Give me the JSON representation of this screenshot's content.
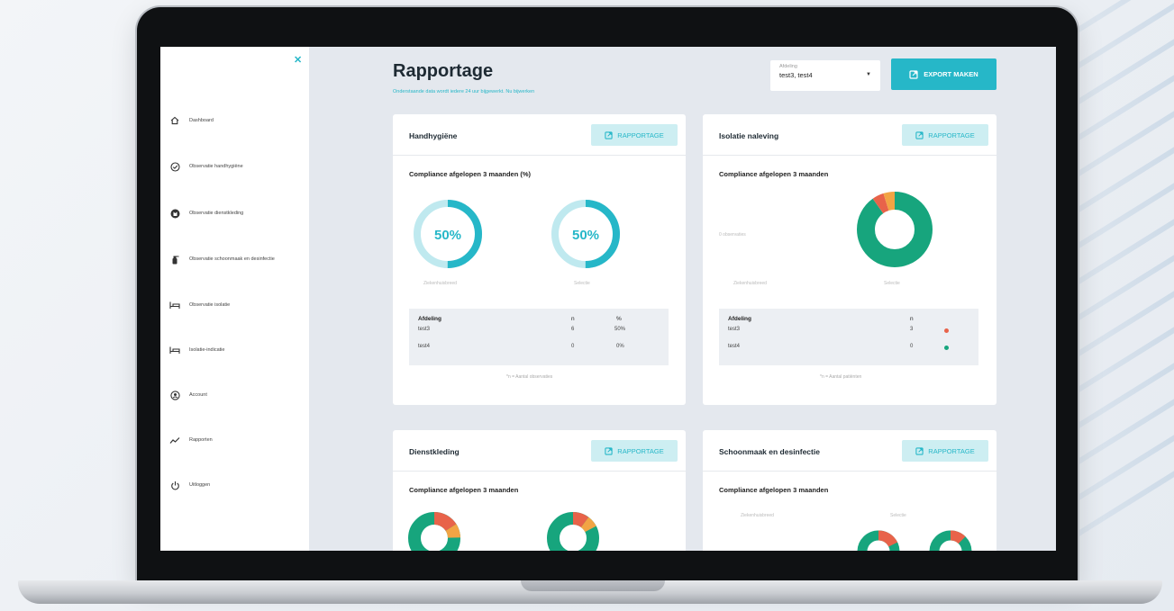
{
  "sidebar": {
    "close_icon": "close-icon",
    "items": [
      {
        "label": "Dashboard",
        "icon": "home-icon"
      },
      {
        "label": "Observatie handhygiëne",
        "icon": "check-circle-icon"
      },
      {
        "label": "Observatie dienstkleding",
        "icon": "uniform-icon"
      },
      {
        "label": "Observatie schoonmaak en desinfectie",
        "icon": "spray-bottle-icon"
      },
      {
        "label": "Observatie isolatie",
        "icon": "bed-icon"
      },
      {
        "label": "Isolatie-indicatie",
        "icon": "bed-icon"
      },
      {
        "label": "Account",
        "icon": "user-circle-icon"
      },
      {
        "label": "Rapporten",
        "icon": "trend-line-icon"
      },
      {
        "label": "Uitloggen",
        "icon": "power-icon"
      }
    ]
  },
  "header": {
    "title": "Rapportage",
    "subtitle": "Onderstaande data wordt iedere 24 uur bijgewerkt. Nu bijwerken",
    "department_label": "Afdeling",
    "department_value": "test3, test4",
    "export_label": "EXPORT MAKEN"
  },
  "colors": {
    "accent": "#26b7c8",
    "green": "#17a57d",
    "red": "#e8634a",
    "orange": "#f2a444"
  },
  "cards": {
    "hand": {
      "title": "Handhygiëne",
      "button": "RAPPORTAGE",
      "compliance": "Compliance afgelopen 3 maanden (%)",
      "gauge1": {
        "value_label": "50%",
        "value": 0.5,
        "caption": "Ziekenhuisbreed"
      },
      "gauge2": {
        "value_label": "50%",
        "value": 0.5,
        "caption": "Selectie"
      },
      "table": {
        "headers": [
          "Afdeling",
          "n",
          "%"
        ],
        "rows": [
          [
            "test3",
            "6",
            "50%"
          ],
          [
            "test4",
            "0",
            "0%"
          ]
        ]
      },
      "footnote": "*n = Aantal observaties"
    },
    "isolation": {
      "title": "Isolatie naleving",
      "button": "RAPPORTAGE",
      "compliance": "Compliance afgelopen 3 maanden",
      "empty_note": "0 observaties",
      "caption1": "Ziekenhuisbreed",
      "caption2": "Selectie",
      "donut": [
        {
          "value": 0.9,
          "color": "green"
        },
        {
          "value": 0.05,
          "color": "red"
        },
        {
          "value": 0.05,
          "color": "orange"
        }
      ],
      "table": {
        "headers": [
          "Afdeling",
          "n"
        ],
        "rows": [
          [
            "test3",
            "3",
            "red"
          ],
          [
            "test4",
            "0",
            "green"
          ]
        ]
      },
      "footnote": "*n = Aantal patiënten"
    },
    "uniform": {
      "title": "Dienstkleding",
      "button": "RAPPORTAGE",
      "compliance": "Compliance afgelopen 3 maanden"
    },
    "cleaning": {
      "title": "Schoonmaak en desinfectie",
      "button": "RAPPORTAGE",
      "compliance": "Compliance afgelopen 3 maanden",
      "caption1": "Ziekenhuisbreed",
      "caption2": "Selectie"
    }
  }
}
